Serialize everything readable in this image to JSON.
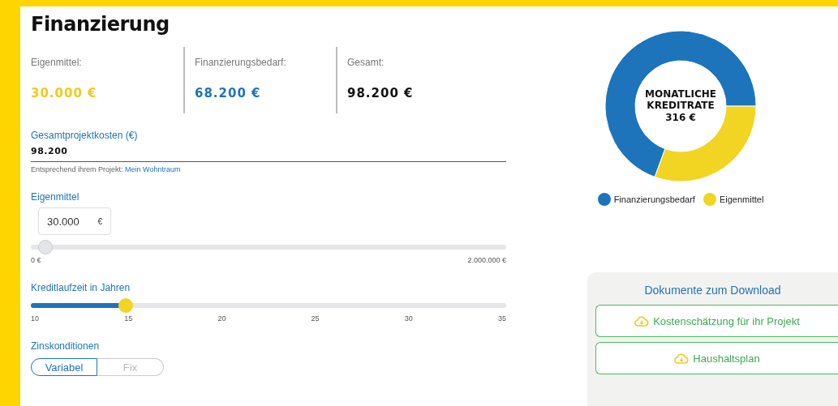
{
  "title": "Finanzierung",
  "summary": [
    {
      "label": "Eigenmittel:",
      "value": "30.000 €",
      "color": "#f2c81e"
    },
    {
      "label": "Finanzierungsbedarf:",
      "value": "68.200 €",
      "color": "#1d74bb"
    },
    {
      "label": "Gesamt:",
      "value": "98.200 €",
      "color": "#111111"
    }
  ],
  "project_costs": {
    "label": "Gesamtprojektkosten (€)",
    "value": "98.200",
    "hint": "Entsprechend ihrem Projekt:",
    "hint_link": "Mein Wohntraum"
  },
  "equity": {
    "label": "Eigenmittel",
    "value": "30.000",
    "unit": "€",
    "level": 0.015,
    "min_label": "0 €",
    "max_label": "2.000.000 €"
  },
  "term": {
    "label": "Kreditlaufzeit in Jahren",
    "level": 0.2,
    "ticks": [
      "10",
      "15",
      "20",
      "25",
      "30",
      "35"
    ]
  },
  "interest": {
    "label": "Zinskonditionen",
    "options": [
      {
        "label": "Variabel",
        "selected": true
      },
      {
        "label": "Fix",
        "selected": false
      }
    ]
  },
  "chart": {
    "center_title": "MONATLICHE KREDITRATE",
    "center_value": "316 €",
    "chart_data": {
      "type": "donut",
      "categories": [
        "Finanzierungsbedarf",
        "Eigenmittel"
      ],
      "values": [
        69.45,
        30.55
      ],
      "colors": [
        "#1d74bb",
        "#f2d422"
      ]
    }
  },
  "downloads": {
    "title": "Dokumente zum Download",
    "items": [
      "Kostenschätzung für ihr Projekt",
      "Haushaltsplan"
    ]
  }
}
